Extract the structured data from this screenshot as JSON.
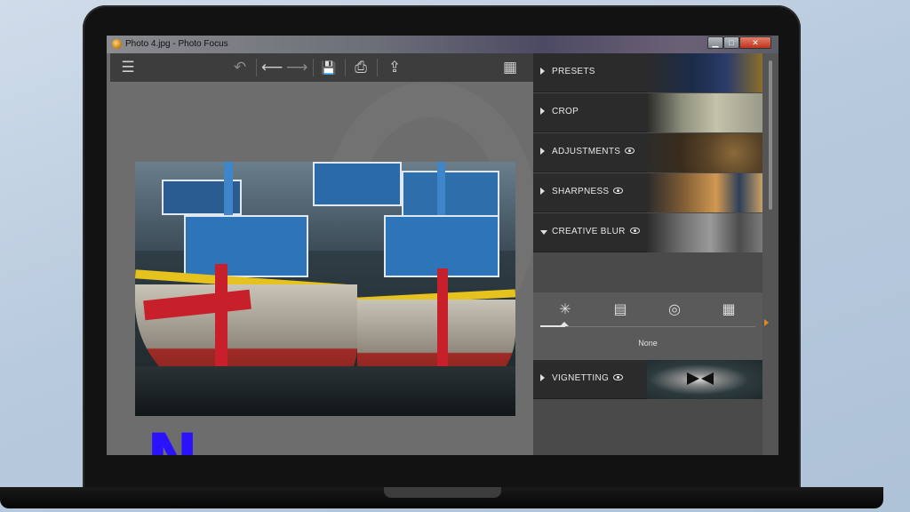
{
  "window": {
    "title": "Photo 4.jpg - Photo Focus",
    "controls": {
      "minimize": "▁",
      "maximize": "□",
      "close": "✕"
    }
  },
  "toolbar": {
    "menu_icon": "☰",
    "revert_icon": "↶",
    "undo_icon": "⟵",
    "redo_icon": "⟶",
    "save_icon": "💾",
    "print_icon": "⎙",
    "share_icon": "⇪",
    "grid_icon": "▦"
  },
  "panel": {
    "sections": [
      {
        "label": "PRESETS",
        "eye": false,
        "expanded": false
      },
      {
        "label": "CROP",
        "eye": false,
        "expanded": false
      },
      {
        "label": "ADJUSTMENTS",
        "eye": true,
        "expanded": false
      },
      {
        "label": "SHARPNESS",
        "eye": true,
        "expanded": false
      },
      {
        "label": "CREATIVE BLUR",
        "eye": true,
        "expanded": true
      },
      {
        "label": "VIGNETTING",
        "eye": true,
        "expanded": false
      }
    ],
    "creative_blur": {
      "options": [
        "✳",
        "▤",
        "◎",
        "▦"
      ],
      "value": "None"
    }
  },
  "colors": {
    "accent": "#e08a1a",
    "panel_bg": "#4a4a4a",
    "section_bg": "#2b2b2b",
    "logo": "#2b12ff"
  },
  "overlay": {
    "logo_letter": "N"
  }
}
